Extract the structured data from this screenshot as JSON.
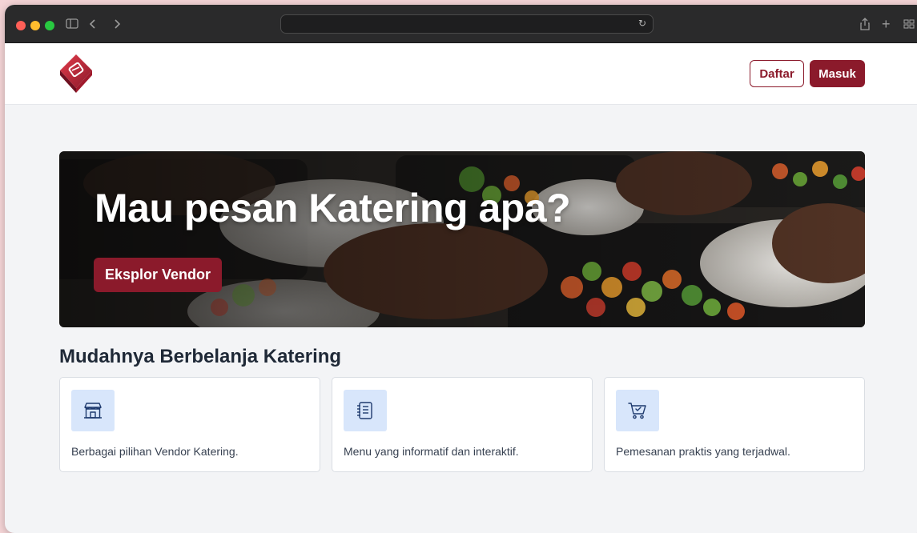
{
  "browser": {
    "icons": [
      "sidebar-icon",
      "back-icon",
      "forward-icon",
      "reload-icon",
      "share-icon",
      "new-tab-icon",
      "tab-overview-icon"
    ]
  },
  "header": {
    "register_label": "Daftar",
    "login_label": "Masuk"
  },
  "hero": {
    "title": "Mau pesan Katering apa?",
    "cta_label": "Eksplor Vendor"
  },
  "features": {
    "title": "Mudahnya Berbelanja Katering",
    "items": [
      {
        "icon": "store-icon",
        "text": "Berbagai pilihan Vendor Katering."
      },
      {
        "icon": "menu-list-icon",
        "text": "Menu yang informatif dan interaktif."
      },
      {
        "icon": "cart-icon",
        "text": "Pemesanan praktis yang terjadwal."
      }
    ]
  },
  "colors": {
    "brand": "#8b1a2b",
    "icon_bg": "#d8e6fb",
    "icon_stroke": "#1e3a6e"
  }
}
